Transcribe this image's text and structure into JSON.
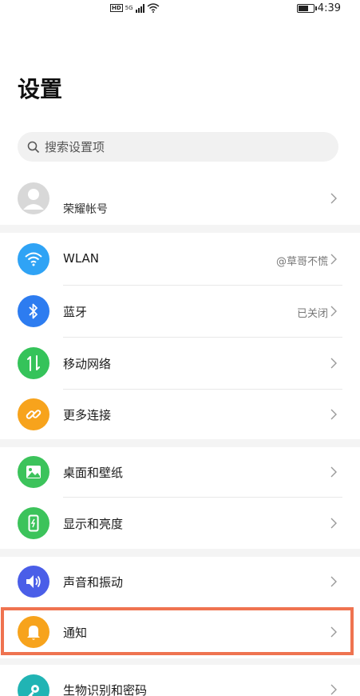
{
  "status_bar": {
    "hd": "HD",
    "network": "5G",
    "time": "4:39"
  },
  "page": {
    "title": "设置"
  },
  "search": {
    "placeholder": "搜索设置项"
  },
  "account": {
    "label": "荣耀帐号"
  },
  "items": [
    {
      "label": "WLAN",
      "value": "@草哥不慌",
      "icon": "wifi-icon",
      "color": "#2fa3f5"
    },
    {
      "label": "蓝牙",
      "value": "已关闭",
      "icon": "bluetooth-icon",
      "color": "#2d7cf0"
    },
    {
      "label": "移动网络",
      "value": "",
      "icon": "mobile-network-icon",
      "color": "#35c35a"
    },
    {
      "label": "更多连接",
      "value": "",
      "icon": "link-icon",
      "color": "#f7a31c"
    },
    {
      "label": "桌面和壁纸",
      "value": "",
      "icon": "wallpaper-icon",
      "color": "#3cc35b"
    },
    {
      "label": "显示和亮度",
      "value": "",
      "icon": "display-icon",
      "color": "#3cc35b"
    },
    {
      "label": "声音和振动",
      "value": "",
      "icon": "sound-icon",
      "color": "#4a5ee8"
    },
    {
      "label": "通知",
      "value": "",
      "icon": "bell-icon",
      "color": "#f7a31c"
    },
    {
      "label": "生物识别和密码",
      "value": "",
      "icon": "key-icon",
      "color": "#21b4b4"
    }
  ],
  "colors": {
    "highlight": "#ef7350",
    "section_gap": "#f4f4f4"
  }
}
